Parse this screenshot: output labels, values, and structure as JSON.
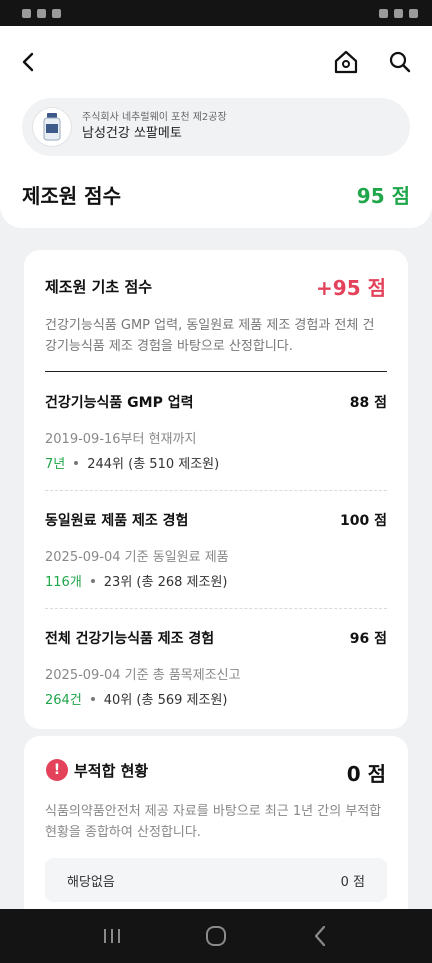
{
  "product": {
    "company": "주식회사 네추럴웨이 포천 제2공장",
    "name": "남성건강 쏘팔메토"
  },
  "manufacturer": {
    "title": "제조원 점수",
    "score": "95 점"
  },
  "basic": {
    "title": "제조원 기초 점수",
    "score": "+95 점",
    "description": "건강기능식품 GMP 업력, 동일원료 제품 제조 경험과 전체 건강기능식품 제조 경험을 바탕으로 산정합니다.",
    "items": [
      {
        "title": "건강기능식품 GMP 업력",
        "score": "88 점",
        "sub": "2019-09-16부터 현재까지",
        "highlight": "7년",
        "rank": "244위 (총 510 제조원)"
      },
      {
        "title": "동일원료 제품 제조 경험",
        "score": "100 점",
        "sub": "2025-09-04 기준 동일원료 제품",
        "highlight": "116개",
        "rank": "23위 (총 268 제조원)"
      },
      {
        "title": "전체 건강기능식품 제조 경험",
        "score": "96 점",
        "sub": "2025-09-04 기준 총 품목제조신고",
        "highlight": "264건",
        "rank": "40위 (총 569 제조원)"
      }
    ]
  },
  "incompliance": {
    "icon": "!",
    "title": "부적합 현황",
    "score": "0 점",
    "description": "식품의약품안전처 제공 자료를 바탕으로 최근 1년 간의 부적합 현황을 종합하여 산정합니다.",
    "row_label": "해당없음",
    "row_score": "0 점"
  },
  "colors": {
    "green": "#1fa64a",
    "red": "#e3425a"
  }
}
